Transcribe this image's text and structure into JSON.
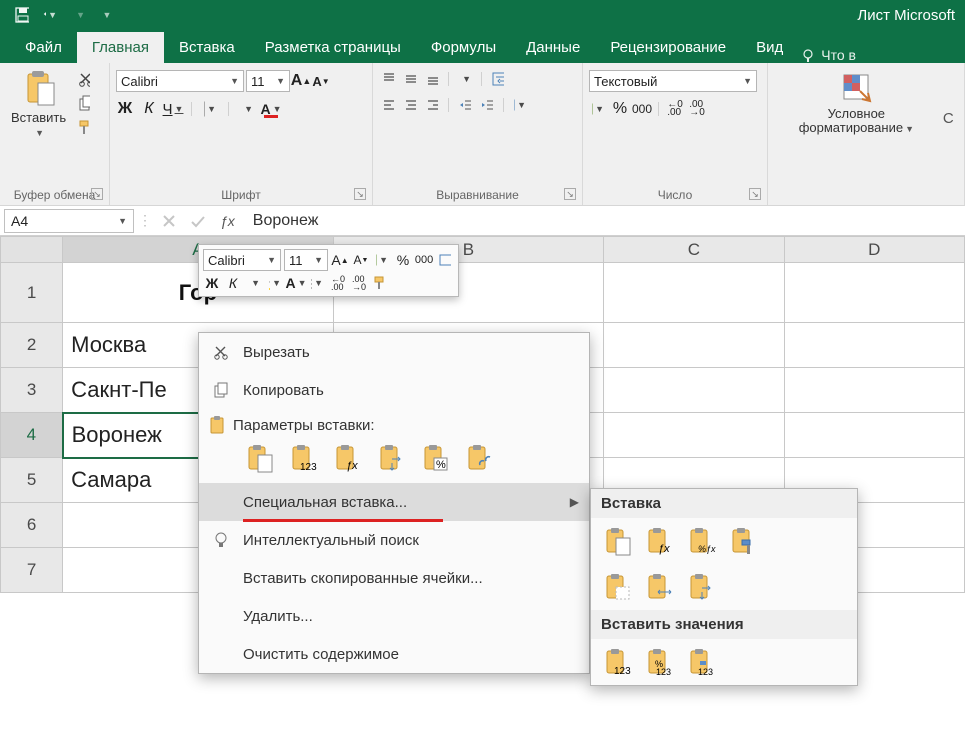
{
  "app_title": "Лист Microsoft",
  "tabs": {
    "file": "Файл",
    "home": "Главная",
    "insert": "Вставка",
    "layout": "Разметка страницы",
    "formulas": "Формулы",
    "data": "Данные",
    "review": "Рецензирование",
    "view": "Вид",
    "tell": "Что в"
  },
  "ribbon": {
    "clipboard": {
      "paste": "Вставить",
      "label": "Буфер обмена"
    },
    "font": {
      "name": "Calibri",
      "size": "11",
      "label": "Шрифт",
      "bold": "Ж",
      "italic": "К",
      "underline": "Ч"
    },
    "align": {
      "label": "Выравнивание"
    },
    "number": {
      "format": "Текстовый",
      "label": "Число",
      "pct": "%",
      "000": "000"
    },
    "cond": {
      "label": "Условное форматирование",
      "styles_hint": "С"
    }
  },
  "namebox": "A4",
  "formula_value": "Воронеж",
  "columns": [
    "A",
    "B",
    "C",
    "D"
  ],
  "rows": [
    {
      "n": "1",
      "a": "Гор",
      "hdr": true
    },
    {
      "n": "2",
      "a": "Москва"
    },
    {
      "n": "3",
      "a": "Сакнт-Пе"
    },
    {
      "n": "4",
      "a": "Воронеж",
      "sel": true
    },
    {
      "n": "5",
      "a": "Самара"
    },
    {
      "n": "6",
      "a": ""
    },
    {
      "n": "7",
      "a": ""
    }
  ],
  "mini": {
    "font": "Calibri",
    "size": "11",
    "bold": "Ж",
    "italic": "К"
  },
  "ctx": {
    "cut": "Вырезать",
    "copy": "Копировать",
    "paste_opts": "Параметры вставки:",
    "special": "Специальная вставка...",
    "smart": "Интеллектуальный поиск",
    "insert": "Вставить скопированные ячейки...",
    "delete": "Удалить...",
    "clear": "Очистить содержимое"
  },
  "sub": {
    "paste": "Вставка",
    "values": "Вставить значения"
  },
  "paste_icons": {
    "v": "",
    "123": "123",
    "fx": "ƒx",
    "fmt": "",
    "pct": "%",
    "link": ""
  },
  "sub_vals_icons": {
    "123": "123",
    "pct123": "%",
    "link123": ""
  }
}
